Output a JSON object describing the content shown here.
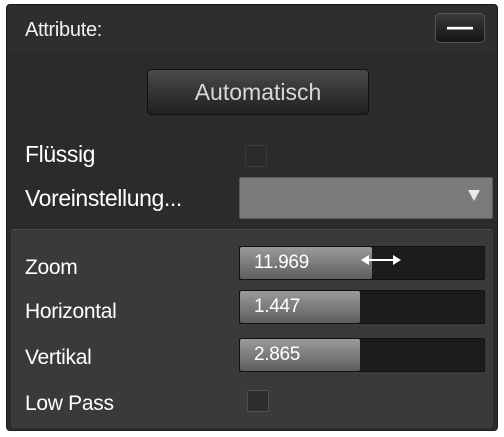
{
  "header": {
    "title": "Attribute:",
    "collapse_label": "—"
  },
  "auto_button": {
    "label": "Automatisch"
  },
  "fluessig": {
    "label": "Flüssig",
    "checked": false
  },
  "voreinstellung": {
    "label": "Voreinstellung...",
    "selected": ""
  },
  "params": {
    "zoom": {
      "label": "Zoom",
      "value": "11.969",
      "fill": 0.54
    },
    "horizontal": {
      "label": "Horizontal",
      "value": "1.447",
      "fill": 0.49
    },
    "vertikal": {
      "label": "Vertikal",
      "value": "2.865",
      "fill": 0.49
    }
  },
  "low_pass": {
    "label": "Low Pass",
    "checked": false
  },
  "colors": {
    "panel_bg": "#2b2b2b",
    "sub_panel_bg": "#3a3a3a",
    "dropdown_bg": "#7b7b7b",
    "slider_track": "#1c1c1c",
    "slider_fill": "#8a8a8a",
    "text": "#ffffff"
  }
}
